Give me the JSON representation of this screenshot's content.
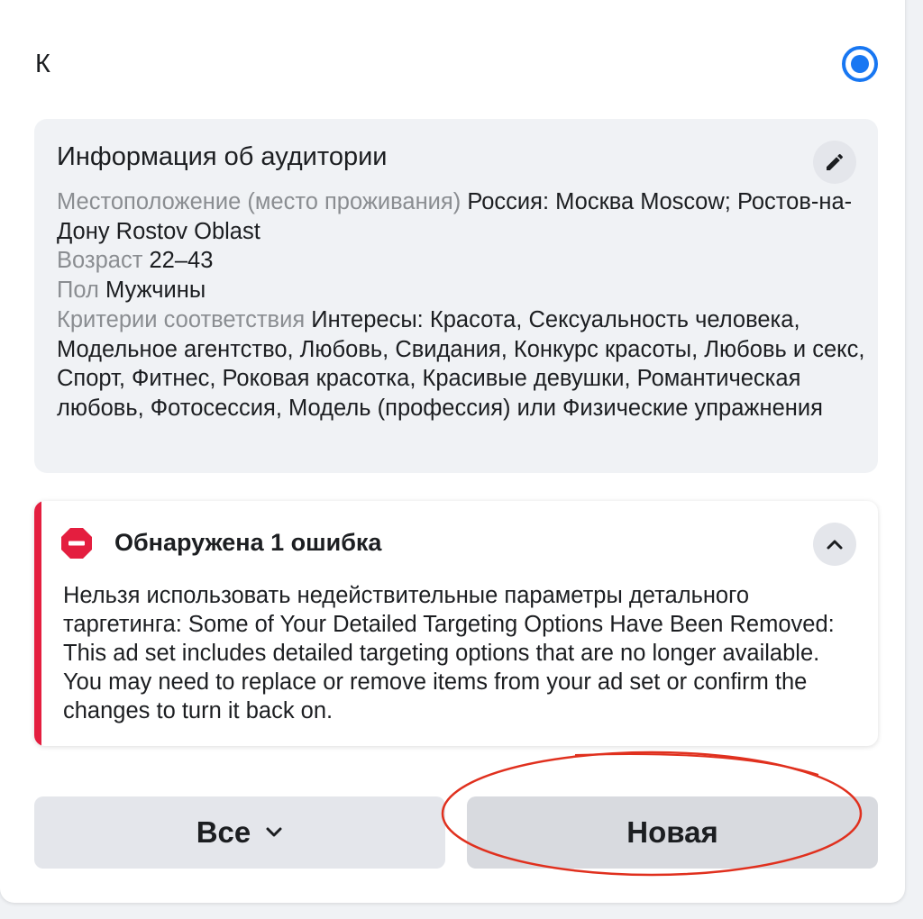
{
  "audience": {
    "name": "К",
    "selected": true
  },
  "info": {
    "title": "Информация об аудитории",
    "location_label": "Местоположение (место проживания)",
    "location_value": "Россия: Москва Moscow; Ростов-на-Дону Rostov Oblast",
    "age_label": "Возраст",
    "age_value": "22–43",
    "gender_label": "Пол",
    "gender_value": "Мужчины",
    "criteria_label": "Критерии соответствия",
    "criteria_value": "Интересы: Красота, Сексуальность человека, Модельное агентство, Любовь, Свидания, Конкурс красоты, Любовь и секс, Спорт, Фитнес, Роковая красотка, Красивые девушки, Романтическая любовь, Фотосессия, Модель (профессия) или Физические упражнения"
  },
  "error": {
    "title": "Обнаружена 1 ошибка",
    "message": "Нельзя использовать недействительные параметры детального таргетинга: Some of Your Detailed Targeting Options Have Been Removed: This ad set includes detailed targeting options that are no longer available. You may need to replace or remove items from your ad set or confirm the changes to turn it back on."
  },
  "buttons": {
    "all_label": "Все",
    "new_label": "Новая"
  },
  "colors": {
    "accent": "#1877f2",
    "error": "#e41e3f",
    "annotation": "#e0301e"
  },
  "icons": {
    "edit": "pencil-icon",
    "error": "error-stop-icon",
    "collapse": "chevron-up-icon",
    "dropdown": "chevron-down-icon"
  }
}
